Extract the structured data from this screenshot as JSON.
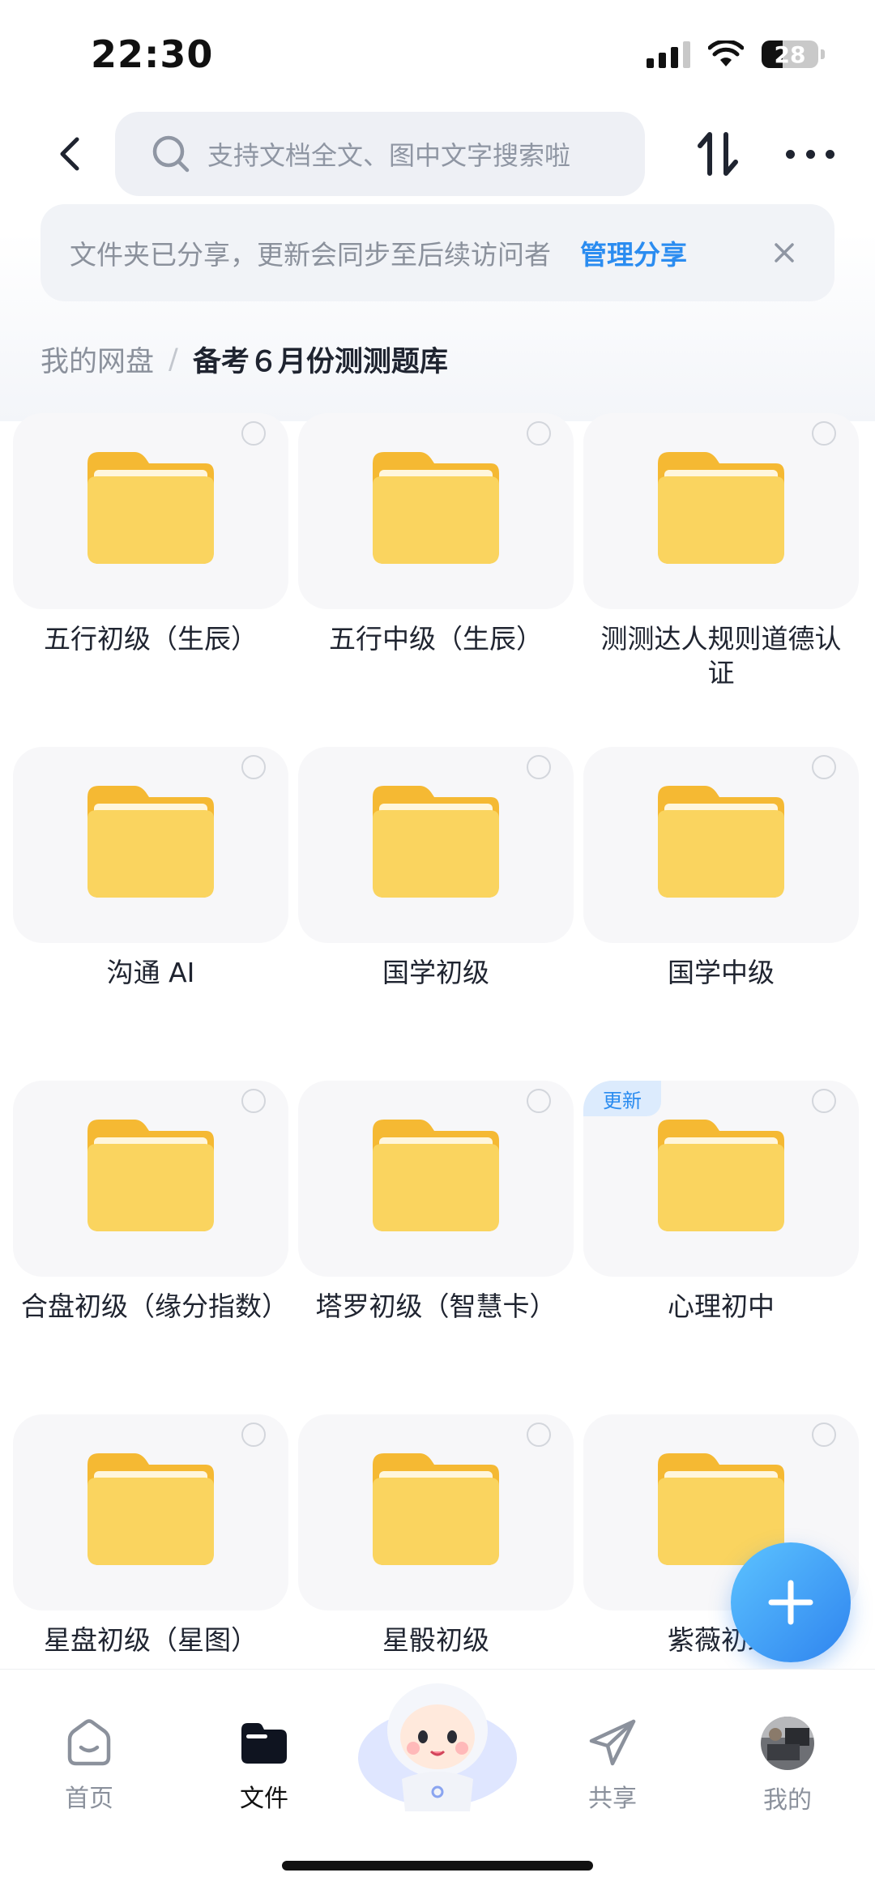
{
  "status_bar": {
    "time": "22:30",
    "battery": "28"
  },
  "search": {
    "placeholder": "支持文档全文、图中文字搜索啦"
  },
  "share_banner": {
    "text": "文件夹已分享，更新会同步至后续访问者",
    "action": "管理分享"
  },
  "breadcrumb": {
    "root": "我的网盘",
    "separator": "/",
    "current": "备考６月份测测题库"
  },
  "folders": [
    {
      "name": "五行初级（生辰）"
    },
    {
      "name": "五行中级（生辰）"
    },
    {
      "name": "测测达人规则道德认证"
    },
    {
      "name": "沟通 AI"
    },
    {
      "name": "国学初级"
    },
    {
      "name": "国学中级"
    },
    {
      "name": "合盘初级（缘分指数）"
    },
    {
      "name": "塔罗初级（智慧卡）"
    },
    {
      "name": "心理初中",
      "badge": "更新"
    },
    {
      "name": "星盘初级（星图）"
    },
    {
      "name": "星骰初级"
    },
    {
      "name": "紫薇初级"
    }
  ],
  "nav": {
    "home": "首页",
    "files": "文件",
    "share": "共享",
    "mine": "我的",
    "active": "files"
  },
  "colors": {
    "accent": "#2b8cf0",
    "folder": "#f7c843"
  }
}
